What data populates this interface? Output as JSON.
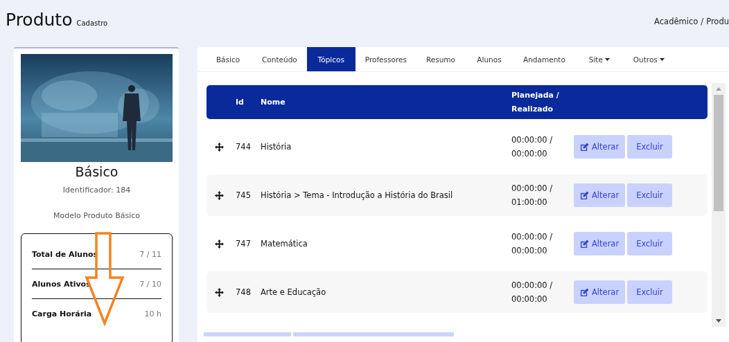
{
  "header": {
    "title": "Produto",
    "subtitle": "Cadastro",
    "breadcrumb": [
      {
        "label": "Acadêmico",
        "separator": "/"
      },
      {
        "label": "Produ"
      }
    ]
  },
  "product": {
    "name": "Básico",
    "identifier": "Identificador: 184",
    "model": "Modelo Produto Básico",
    "stats": [
      {
        "label": "Total de Alunos",
        "value": "7 / 11"
      },
      {
        "label": "Alunos Ativos",
        "value": "7 / 10"
      },
      {
        "label": "Carga Horária",
        "value": "10 h"
      }
    ]
  },
  "tabs": [
    {
      "label": "Básico",
      "selected": false,
      "dropdown": false
    },
    {
      "label": "Conteúdo",
      "selected": false,
      "dropdown": false
    },
    {
      "label": "Tópicos",
      "selected": true,
      "dropdown": false
    },
    {
      "label": "Professores",
      "selected": false,
      "dropdown": false
    },
    {
      "label": "Resumo",
      "selected": false,
      "dropdown": false
    },
    {
      "label": "Alunos",
      "selected": false,
      "dropdown": false
    },
    {
      "label": "Andamento",
      "selected": false,
      "dropdown": false
    },
    {
      "label": "Site",
      "selected": false,
      "dropdown": true
    },
    {
      "label": "Outros",
      "selected": false,
      "dropdown": true
    }
  ],
  "table": {
    "columns": [
      "Id",
      "Nome",
      "Planejada / Realizado"
    ],
    "rows": [
      {
        "id": "744",
        "name": "História",
        "planned": "00:00:00 /",
        "done": "00:00:00",
        "edit": "Alterar",
        "delete": "Excluir"
      },
      {
        "id": "745",
        "name": "História > Tema - Introdução a História do Brasil",
        "planned": "00:00:00 /",
        "done": "01:00:00",
        "edit": "Alterar",
        "delete": "Excluir"
      },
      {
        "id": "747",
        "name": "Matemática",
        "planned": "00:00:00 /",
        "done": "00:00:00",
        "edit": "Alterar",
        "delete": "Excluir"
      },
      {
        "id": "748",
        "name": "Arte e Educação",
        "planned": "00:00:00 /",
        "done": "00:00:00",
        "edit": "Alterar",
        "delete": "Excluir"
      }
    ]
  },
  "annotation": {
    "kind": "down-arrow"
  }
}
